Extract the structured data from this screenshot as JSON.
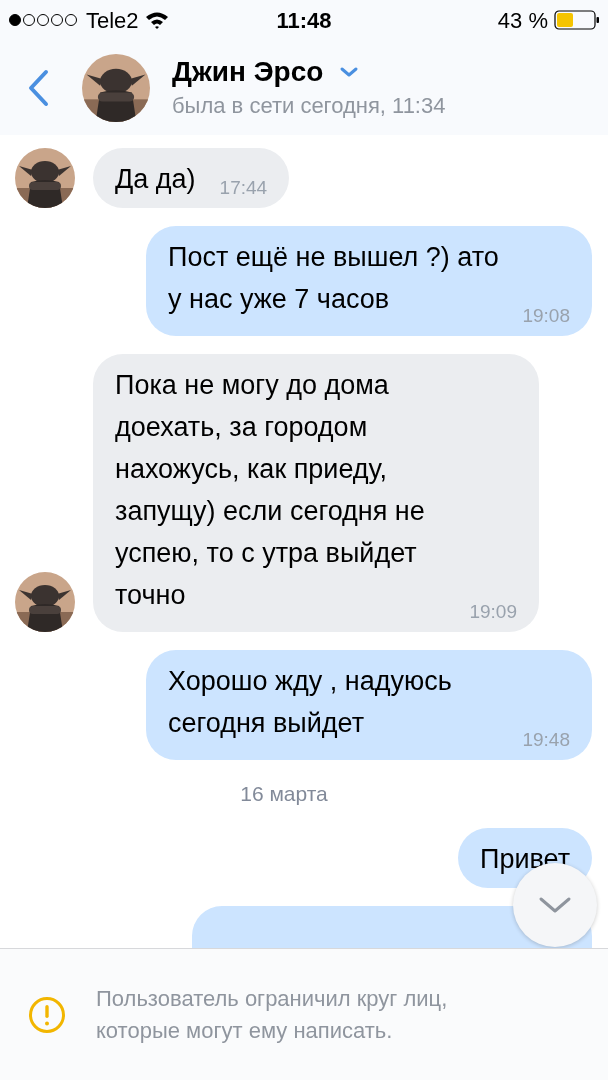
{
  "status_bar": {
    "carrier": "Tele2",
    "time": "11:48",
    "battery": "43 %"
  },
  "header": {
    "name": "Джин Эрсо",
    "status": "была в сети сегодня, 11:34"
  },
  "messages": [
    {
      "kind": "incoming",
      "text": "Да да)",
      "time": "17:44",
      "show_avatar": true
    },
    {
      "kind": "outgoing",
      "text": "Пост ещё не вышел ?) ато у нас уже 7 часов",
      "time": "19:08"
    },
    {
      "kind": "incoming",
      "text": "Пока не могу до дома доехать, за городом нахожусь, как приеду, запущу) если сегодня не успею, то с утра выйдет точно",
      "time": "19:09",
      "show_avatar": true
    },
    {
      "kind": "outgoing",
      "text": "Хорошо жду , надуюсь сегодня выйдет",
      "time": "19:48"
    },
    {
      "kind": "date",
      "text": "16 марта"
    },
    {
      "kind": "outgoing",
      "text": "Привет"
    },
    {
      "kind": "outgoing_cut"
    }
  ],
  "notice": "Пользователь ограничил круг лиц, которые могут ему написать."
}
